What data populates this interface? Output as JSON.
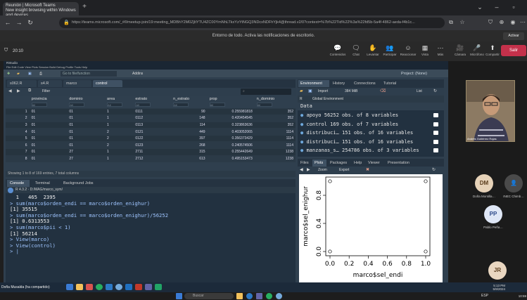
{
  "browser": {
    "tab_title": "Reunión | Microsoft Teams",
    "tab_subtitle": "New insight browsing within Windows and devices",
    "url": "https://teams.microsoft.com/_#/l/meetup-join/19:meeting_MDBhY2M0ZjItYTU4ZC00YmNhLTkxYzYtNGQ3NDcxNDFhYjk4@thread.v2/0?context=%7b%22Tid%22%3a%22fd5b-5a4f-4862-aeda-f4b1c..."
  },
  "teams": {
    "notice": "Entorno de todo. Activa las notificaciones de escritorio.",
    "activate_label": "Activar",
    "timer": "20:10",
    "controls": [
      {
        "icon": "💬",
        "label": "Contenidos"
      },
      {
        "icon": "🗨",
        "label": "Chat"
      },
      {
        "icon": "✋",
        "label": "Levantar"
      },
      {
        "icon": "👥",
        "label": "Participar"
      },
      {
        "icon": "☺",
        "label": "Reaccionar"
      },
      {
        "icon": "▦",
        "label": "Vista"
      },
      {
        "icon": "⋯",
        "label": "Más"
      }
    ],
    "controls_right": [
      {
        "icon": "🎥",
        "label": "Cámara"
      },
      {
        "icon": "🎤",
        "label": "Micrófono"
      },
      {
        "icon": "⬆",
        "label": "Compartir"
      }
    ],
    "leave_label": "Salir"
  },
  "rstudio": {
    "title": "RStudio",
    "menu": "File  Edit  Code  View  Plots  Session  Build  Debug  Profile  Tools  Help",
    "goto_label": "Go to file/function",
    "addins_label": "Addins",
    "project_label": "Project: (None)",
    "data_tabs": [
      "s062.R",
      "s4.R",
      "marco",
      "control"
    ],
    "filter_label": "Filter",
    "search_placeholder": "",
    "filter_placeholder": "All",
    "columns": [
      "",
      "provincia",
      "dominio",
      "area",
      "estrato",
      "n_estrato",
      "prop",
      "n_dominio"
    ],
    "rows": [
      [
        "1",
        "01",
        "01",
        "1",
        "0111",
        "90",
        "0.255981818",
        "352"
      ],
      [
        "2",
        "01",
        "01",
        "1",
        "0112",
        "148",
        "0.420454545",
        "352"
      ],
      [
        "3",
        "01",
        "01",
        "1",
        "0113",
        "114",
        "0.323863636",
        "352"
      ],
      [
        "4",
        "01",
        "01",
        "2",
        "0121",
        "449",
        "0.403052065",
        "1114"
      ],
      [
        "5",
        "01",
        "01",
        "2",
        "0122",
        "397",
        "0.356373429",
        "1114"
      ],
      [
        "6",
        "01",
        "01",
        "2",
        "0123",
        "268",
        "0.240574506",
        "1114"
      ],
      [
        "7",
        "01",
        "27",
        "1",
        "2711",
        "315",
        "0.255442649",
        "1238"
      ],
      [
        "8",
        "01",
        "27",
        "1",
        "2712",
        "613",
        "0.495153473",
        "1238"
      ]
    ],
    "status": "Showing 1 to 8 of 169 entries, 7 total columns",
    "console_tabs": [
      "Console",
      "Terminal",
      "Background Jobs"
    ],
    "console_path": "R 4.3.2 · D:/MAG/marco_sym/",
    "console_lines": [
      {
        "type": "out",
        "text": "  1   465  2395"
      },
      {
        "type": "cmd",
        "text": "> sum(marco$orden_endi == marco$orden_enighur)"
      },
      {
        "type": "out",
        "text": "[1] 35515"
      },
      {
        "type": "cmd",
        "text": "> sum(marco$orden_endi == marco$orden_enighur)/56252"
      },
      {
        "type": "out",
        "text": "[1] 0.6313553"
      },
      {
        "type": "cmd",
        "text": "> sum(marco$pii < 1)"
      },
      {
        "type": "out",
        "text": "[1] 56214"
      },
      {
        "type": "cmd",
        "text": "> View(marco)"
      },
      {
        "type": "cmd",
        "text": "> View(control)"
      },
      {
        "type": "cmd",
        "text": "> |"
      }
    ],
    "env_tabs": [
      "Environment",
      "History",
      "Connections",
      "Tutorial"
    ],
    "import_label": "Import",
    "memory_label": "384 MiB",
    "list_label": "List",
    "r_label": "R",
    "global_env_label": "Global Environment",
    "env_section": "Data",
    "env_items": [
      {
        "name": "apoyo",
        "desc": "56252 obs. of 8 variables"
      },
      {
        "name": "control",
        "desc": "169 obs. of 7 variables"
      },
      {
        "name": "distribuci…",
        "desc": "151 obs. of 16 variables"
      },
      {
        "name": "distribuci…",
        "desc": "151 obs. of 16 variables"
      },
      {
        "name": "manzanas_s…",
        "desc": "254786 obs. of 3 variables"
      }
    ],
    "plot_tabs": [
      "Files",
      "Plots",
      "Packages",
      "Help",
      "Viewer",
      "Presentation"
    ],
    "zoom_label": "Zoom",
    "export_label": "Export"
  },
  "chart_data": {
    "type": "scatter",
    "xlabel": "marco$sel_endi",
    "ylabel": "marco$sel_enighur",
    "xticks": [
      "0.0",
      "0.2",
      "0.4",
      "0.6",
      "0.8",
      "1.0"
    ],
    "yticks": [
      "0.0",
      "0.4",
      "0.8"
    ],
    "xlim": [
      0,
      1
    ],
    "ylim": [
      0,
      1
    ],
    "points": [
      [
        0,
        0
      ],
      [
        1,
        0
      ],
      [
        0,
        1
      ],
      [
        1,
        1
      ]
    ]
  },
  "participants": {
    "presenter_name": "Andrés Gutiérrez Rojas",
    "people": [
      {
        "initials": "DM",
        "name": "Doña Montilla…",
        "bg": "#e6d2b8",
        "fg": "#5a3c1c"
      },
      {
        "initials": "",
        "name": "INEC Chimb…",
        "bg": "#4a4a4a",
        "fg": "#ddd"
      },
      {
        "initials": "PP",
        "name": "Pablo Peña…",
        "bg": "#dfe7f6",
        "fg": "#2d4a8a"
      },
      {
        "initials": "JR",
        "name": "",
        "bg": "#e9d6c0",
        "fg": "#5a3c1c"
      }
    ]
  },
  "taskbar": {
    "inner_label": "Doña Musalda (ha compartido)",
    "inner_time": "5:13 PM",
    "inner_date": "5/9/2024",
    "search_label": "Buscar",
    "outer_time": "10:59",
    "lang": "ESP"
  }
}
